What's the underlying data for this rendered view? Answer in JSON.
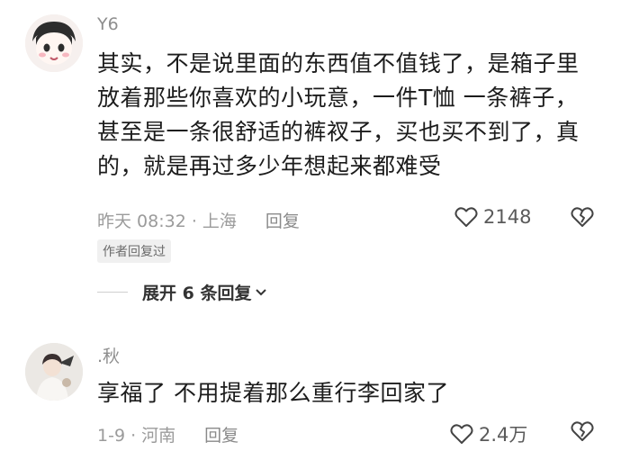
{
  "comments": [
    {
      "username": "Y6",
      "lines": [
        "其实，不是说里面的东西值不值钱了，是箱子里",
        "放着那些你喜欢的小玩意，一件T恤 一条裤子，",
        "甚至是一条很舒适的裤衩子，买也买不到了，真",
        "的，就是再过多少年想起来都难受"
      ],
      "time_location": "昨天 08:32 · 上海",
      "reply_label": "回复",
      "likes": "2148",
      "badge": "作者回复过",
      "expand_label": "展开 6 条回复"
    },
    {
      "username": ".秋",
      "lines": [
        "享福了 不用提着那么重行李回家了"
      ],
      "time_location": "1-9 · 河南",
      "reply_label": "回复",
      "likes": "2.4万"
    }
  ]
}
